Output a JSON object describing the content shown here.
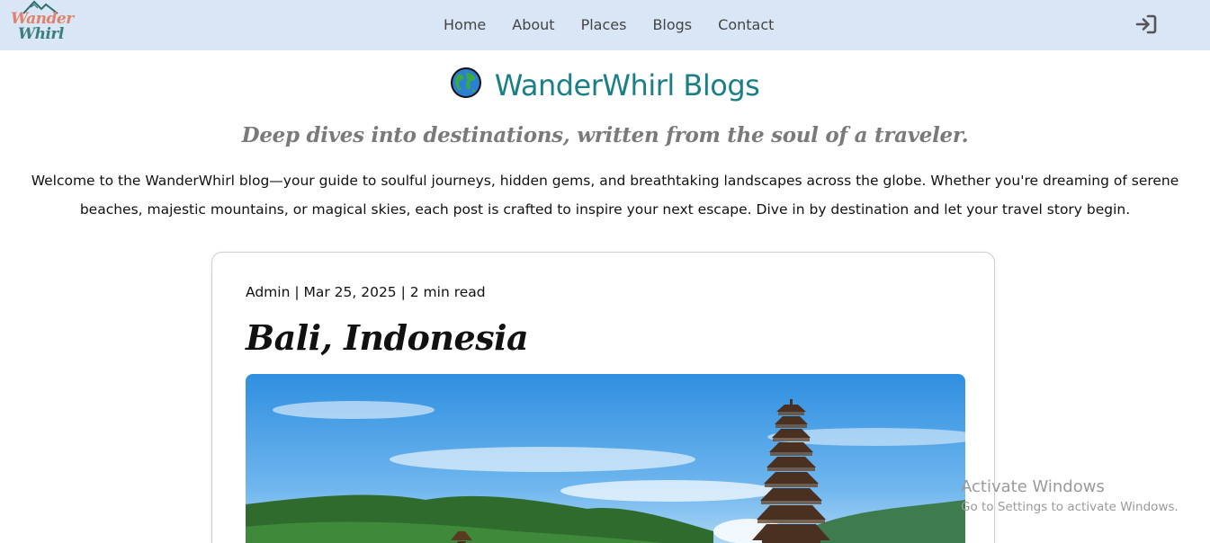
{
  "header": {
    "logo": {
      "line1": "Wander",
      "line2": "Whirl"
    },
    "nav": [
      {
        "label": "Home"
      },
      {
        "label": "About"
      },
      {
        "label": "Places"
      },
      {
        "label": "Blogs"
      },
      {
        "label": "Contact"
      }
    ],
    "login_icon": "sign-in-icon"
  },
  "hero": {
    "icon": "globe-icon",
    "title": "WanderWhirl Blogs",
    "tagline": "Deep dives into destinations, written from the soul of a traveler.",
    "intro": "Welcome to the WanderWhirl blog—your guide to soulful journeys, hidden gems, and breathtaking landscapes across the globe. Whether you're dreaming of serene beaches, majestic mountains, or magical skies, each post is crafted to inspire your next escape. Dive in by destination and let your travel story begin."
  },
  "post": {
    "meta": "Admin | Mar 25, 2025 | 2 min read",
    "title": "Bali, Indonesia"
  },
  "watermark": {
    "line1": "Activate Windows",
    "line2": "Go to Settings to activate Windows."
  },
  "colors": {
    "header_bg": "#d9e6f6",
    "title_teal": "#1b7f88",
    "logo_coral": "#e0826b",
    "logo_teal": "#3b7e7c"
  }
}
